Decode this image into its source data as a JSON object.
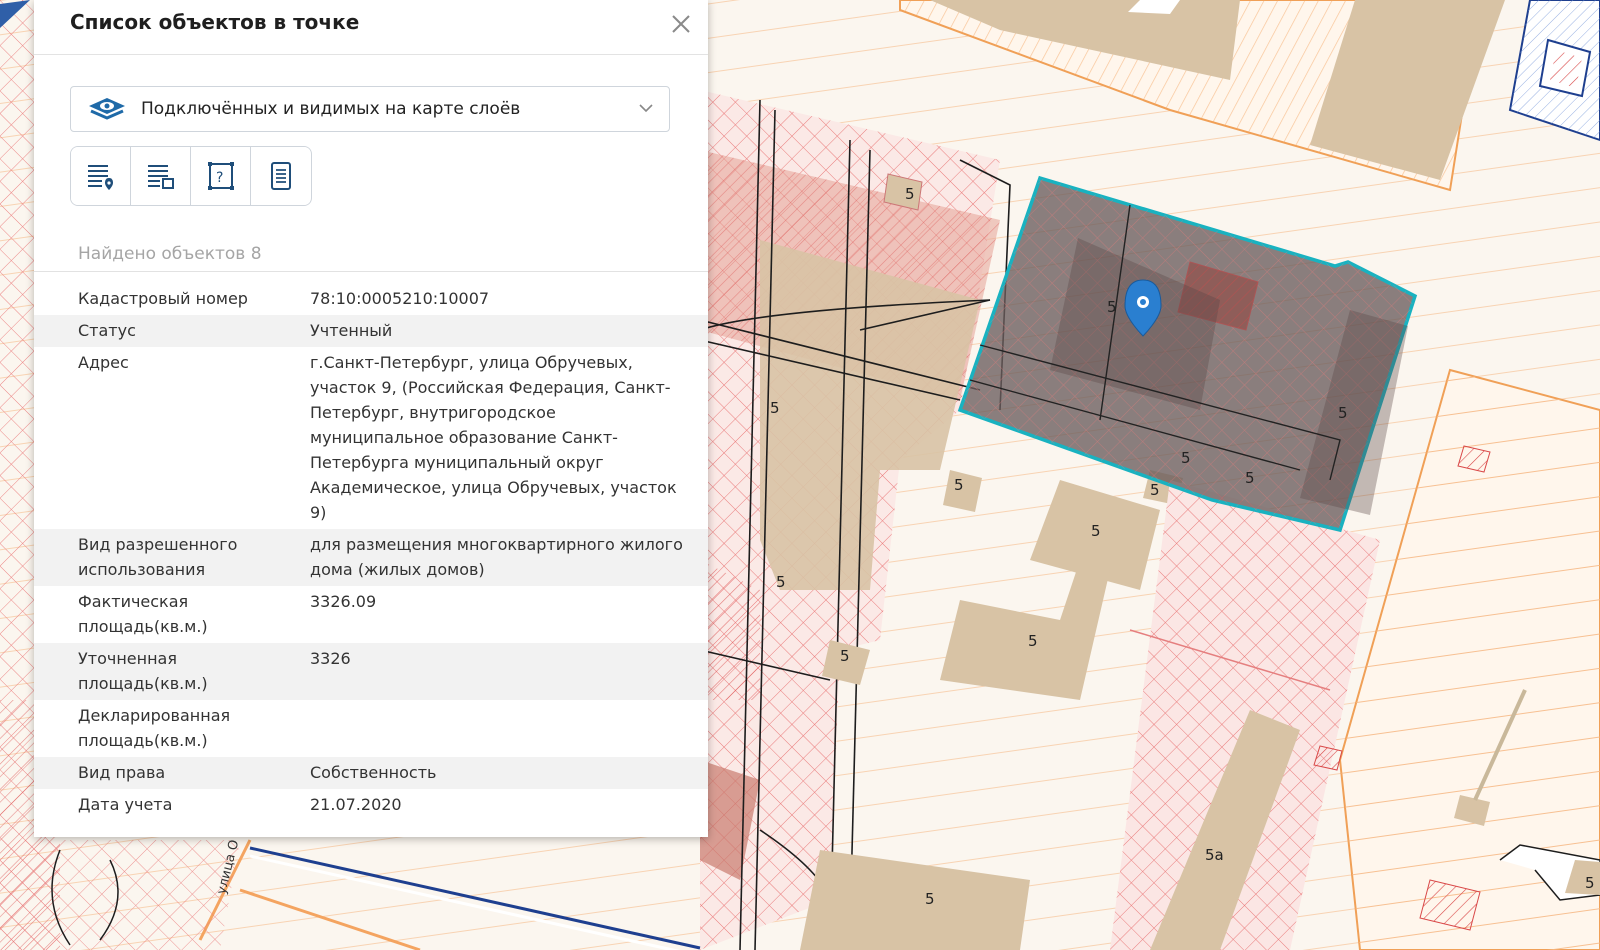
{
  "panel": {
    "title": "Список объектов в точке",
    "layer_selector": "Подключённых и видимых на карте слоёв",
    "toolbar": [
      {
        "icon": "list-pin-icon"
      },
      {
        "icon": "list-area-icon"
      },
      {
        "icon": "help-frame-icon"
      },
      {
        "icon": "document-icon"
      }
    ],
    "found_label": "Найдено объектов 8",
    "properties": [
      {
        "label": "Кадастровый номер",
        "value": "78:10:0005210:10007"
      },
      {
        "label": "Статус",
        "value": "Учтенный"
      },
      {
        "label": "Адрес",
        "value": "г.Санкт-Петербург, улица Обручевых, участок 9, (Российская Федерация, Санкт-Петербург, внутригородское муниципальное образование Санкт-Петербурга муниципальный округ Академическое, улица Обручевых, участок 9)"
      },
      {
        "label": "Вид разрешенного использования",
        "value": "для размещения многоквартирного жилого дома (жилых домов)"
      },
      {
        "label": "Фактическая площадь(кв.м.)",
        "value": "3326.09"
      },
      {
        "label": "Уточненная площадь(кв.м.)",
        "value": "3326"
      },
      {
        "label": "Декларированная площадь(кв.м.)",
        "value": ""
      },
      {
        "label": "Вид права",
        "value": "Собственность"
      },
      {
        "label": "Дата учета",
        "value": "21.07.2020"
      }
    ]
  },
  "map": {
    "building_labels": [
      "5",
      "5",
      "5",
      "5",
      "5",
      "5",
      "5",
      "5",
      "5",
      "5",
      "5",
      "5",
      "5",
      "5а",
      "5"
    ],
    "street_label": "улица О"
  },
  "colors": {
    "accent": "#1f6aa8",
    "selection_outline": "#19b2c0",
    "building": "#d8c3a5",
    "parcel_line": "#f0a057",
    "hatch_red": "#e05a5a"
  }
}
